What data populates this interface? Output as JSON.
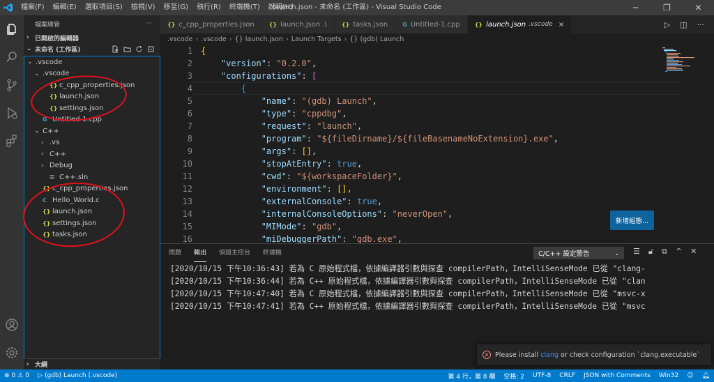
{
  "window": {
    "title": "launch.json - 未命名 (工作區) - Visual Studio Code",
    "menu": [
      "檔案(F)",
      "編輯(E)",
      "選取項目(S)",
      "檢視(V)",
      "移至(G)",
      "執行(R)",
      "終端機(T)",
      "說明(H)"
    ]
  },
  "sidebar": {
    "title": "檔案總管",
    "more": "···",
    "open_editors": "已開啟的編輯器",
    "workspace": "未命名 (工作區)",
    "tree": [
      {
        "label": ".vscode",
        "indent": 0,
        "twisty": "⌄",
        "icon": ""
      },
      {
        "label": ".vscode",
        "indent": 1,
        "twisty": "⌄",
        "icon": ""
      },
      {
        "label": "c_cpp_properties.json",
        "indent": 2,
        "twisty": "",
        "icon": "{}",
        "kind": "json"
      },
      {
        "label": "launch.json",
        "indent": 2,
        "twisty": "",
        "icon": "{}",
        "kind": "json"
      },
      {
        "label": "settings.json",
        "indent": 2,
        "twisty": "",
        "icon": "{}",
        "kind": "json"
      },
      {
        "label": "Untitled-1.cpp",
        "indent": 1,
        "twisty": "",
        "icon": "G",
        "kind": "cpp"
      },
      {
        "label": "C++",
        "indent": 1,
        "twisty": "⌄",
        "icon": ""
      },
      {
        "label": ".vs",
        "indent": 2,
        "twisty": "›",
        "icon": ""
      },
      {
        "label": "C++",
        "indent": 2,
        "twisty": "›",
        "icon": ""
      },
      {
        "label": "Debug",
        "indent": 2,
        "twisty": "›",
        "icon": ""
      },
      {
        "label": "C++.sln",
        "indent": 2,
        "twisty": "",
        "icon": "☰",
        "kind": "sln"
      },
      {
        "label": "c_cpp_properties.json",
        "indent": 1,
        "twisty": "",
        "icon": "{}",
        "kind": "json"
      },
      {
        "label": "Hello_World.c",
        "indent": 1,
        "twisty": "",
        "icon": "C",
        "kind": "c"
      },
      {
        "label": "launch.json",
        "indent": 1,
        "twisty": "",
        "icon": "{}",
        "kind": "json"
      },
      {
        "label": "settings.json",
        "indent": 1,
        "twisty": "",
        "icon": "{}",
        "kind": "json"
      },
      {
        "label": "tasks.json",
        "indent": 1,
        "twisty": "",
        "icon": "{}",
        "kind": "json"
      }
    ],
    "outline": "大綱"
  },
  "tabs": [
    {
      "icon": "{}",
      "label": "c_cpp_properties.json",
      "kind": "json",
      "active": false,
      "close": ""
    },
    {
      "icon": "{}",
      "label": "launch.json .\\",
      "kind": "json",
      "active": false,
      "close": ""
    },
    {
      "icon": "{}",
      "label": "tasks.json",
      "kind": "json",
      "active": false,
      "close": ""
    },
    {
      "icon": "G",
      "label": "Untitled-1.cpp",
      "kind": "cpp",
      "active": false,
      "close": ""
    },
    {
      "icon": "{}",
      "label": "launch.json",
      "suffix": ".vscode",
      "kind": "json",
      "active": true,
      "close": "×"
    }
  ],
  "breadcrumb": [
    ".vscode",
    ".vscode",
    "{} launch.json",
    "Launch Targets",
    "{} (gdb) Launch"
  ],
  "editor": {
    "line_numbers": [
      "1",
      "2",
      "3",
      "4",
      "5",
      "6",
      "7",
      "8",
      "9",
      "10",
      "11",
      "12",
      "13",
      "14",
      "15",
      "16"
    ],
    "add_config_button": "新增組態..."
  },
  "code_lines": [
    [
      [
        "p1",
        "{"
      ]
    ],
    [
      [
        "",
        "    "
      ],
      [
        "k",
        "\"version\""
      ],
      [
        "",
        ": "
      ],
      [
        "s",
        "\"0.2.0\""
      ],
      [
        "",
        ","
      ]
    ],
    [
      [
        "",
        "    "
      ],
      [
        "k",
        "\"configurations\""
      ],
      [
        "",
        ": "
      ],
      [
        "p2",
        "["
      ]
    ],
    [
      [
        "",
        "        "
      ],
      [
        "p3",
        "{"
      ]
    ],
    [
      [
        "",
        "            "
      ],
      [
        "k",
        "\"name\""
      ],
      [
        "",
        ": "
      ],
      [
        "s",
        "\"(gdb) Launch\""
      ],
      [
        "",
        ","
      ]
    ],
    [
      [
        "",
        "            "
      ],
      [
        "k",
        "\"type\""
      ],
      [
        "",
        ": "
      ],
      [
        "s",
        "\"cppdbg\""
      ],
      [
        "",
        ","
      ]
    ],
    [
      [
        "",
        "            "
      ],
      [
        "k",
        "\"request\""
      ],
      [
        "",
        ": "
      ],
      [
        "s",
        "\"launch\""
      ],
      [
        "",
        ","
      ]
    ],
    [
      [
        "",
        "            "
      ],
      [
        "k",
        "\"program\""
      ],
      [
        "",
        ": "
      ],
      [
        "s",
        "\"${fileDirname}/${fileBasenameNoExtension}.exe\""
      ],
      [
        "",
        ","
      ]
    ],
    [
      [
        "",
        "            "
      ],
      [
        "k",
        "\"args\""
      ],
      [
        "",
        ": "
      ],
      [
        "p1",
        "[]"
      ],
      [
        "",
        ","
      ]
    ],
    [
      [
        "",
        "            "
      ],
      [
        "k",
        "\"stopAtEntry\""
      ],
      [
        "",
        ": "
      ],
      [
        "b",
        "true"
      ],
      [
        "",
        ","
      ]
    ],
    [
      [
        "",
        "            "
      ],
      [
        "k",
        "\"cwd\""
      ],
      [
        "",
        ": "
      ],
      [
        "s",
        "\"${workspaceFolder}\""
      ],
      [
        "",
        ","
      ]
    ],
    [
      [
        "",
        "            "
      ],
      [
        "k",
        "\"environment\""
      ],
      [
        "",
        ": "
      ],
      [
        "p1",
        "[]"
      ],
      [
        "",
        ","
      ]
    ],
    [
      [
        "",
        "            "
      ],
      [
        "k",
        "\"externalConsole\""
      ],
      [
        "",
        ": "
      ],
      [
        "b",
        "true"
      ],
      [
        "",
        ","
      ]
    ],
    [
      [
        "",
        "            "
      ],
      [
        "k",
        "\"internalConsoleOptions\""
      ],
      [
        "",
        ": "
      ],
      [
        "s",
        "\"neverOpen\""
      ],
      [
        "",
        ","
      ]
    ],
    [
      [
        "",
        "            "
      ],
      [
        "k",
        "\"MIMode\""
      ],
      [
        "",
        ": "
      ],
      [
        "s",
        "\"gdb\""
      ],
      [
        "",
        ","
      ]
    ],
    [
      [
        "",
        "            "
      ],
      [
        "k",
        "\"miDebuggerPath\""
      ],
      [
        "",
        ": "
      ],
      [
        "s",
        "\"gdb.exe\""
      ],
      [
        "",
        ","
      ]
    ]
  ],
  "panel": {
    "tabs": [
      "問題",
      "輸出",
      "偵錯主控台",
      "終端機"
    ],
    "active_tab": 1,
    "channel": "C/C++ 設定警告",
    "output": [
      "[2020/10/15 下午10:36:43] 若為 C 原始程式檔，依據編譯器引數與探查 compilerPath，IntelliSenseMode 已從 \"clang-",
      "[2020/10/15 下午10:36:44] 若為 C++ 原始程式檔，依據編譯器引數與探查 compilerPath，IntelliSenseMode 已從 \"clan",
      "[2020/10/15 下午10:47:40] 若為 C 原始程式檔，依據編譯器引數與探查 compilerPath，IntelliSenseMode 已從 \"msvc-x",
      "[2020/10/15 下午10:47:41] 若為 C++ 原始程式檔，依據編譯器引數與探查 compilerPath，IntelliSenseMode 已從 \"msvc"
    ]
  },
  "notification": {
    "before": "Please install",
    "link": "clang",
    "after": "or check configuration `clang.executable`"
  },
  "status": {
    "errors": "0",
    "warnings": "0",
    "debug": "(gdb) Launch (.vscode)",
    "position": "第 4 行，第 8 欄",
    "spaces": "空格: 2",
    "encoding": "UTF-8",
    "eol": "CRLF",
    "language": "JSON with Comments",
    "platform": "Win32"
  },
  "colors": {
    "accent": "#007acc",
    "annotation_circle": "#e2101e",
    "button": "#0e639c"
  }
}
